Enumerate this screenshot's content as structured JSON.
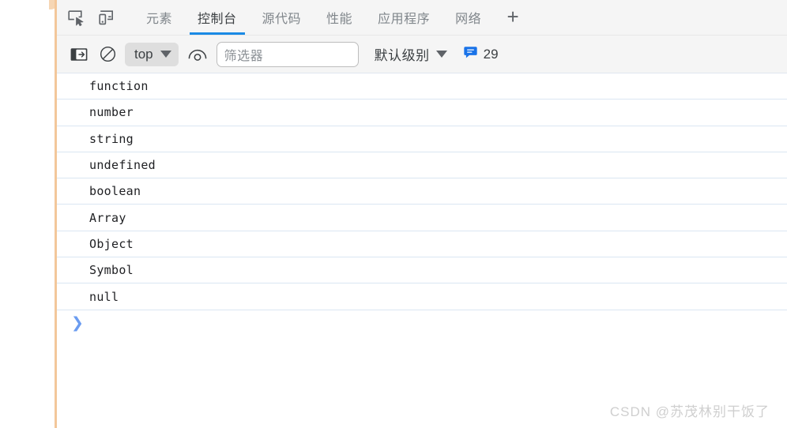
{
  "window": {
    "app": "Chrome DevTools",
    "panel_active": "控制台"
  },
  "tabbar": {
    "inspect_icon": "inspect-element-icon",
    "device_icon": "device-toolbar-icon",
    "add_label": "+",
    "tabs": [
      {
        "label": "元素",
        "active": false
      },
      {
        "label": "控制台",
        "active": true
      },
      {
        "label": "源代码",
        "active": false
      },
      {
        "label": "性能",
        "active": false
      },
      {
        "label": "应用程序",
        "active": false
      },
      {
        "label": "网络",
        "active": false
      }
    ]
  },
  "console_toolbar": {
    "sidebar_toggle_icon": "console-sidebar-toggle-icon",
    "clear_icon": "clear-console-icon",
    "context_value": "top",
    "live_expression_icon": "live-expression-eye-icon",
    "filter_placeholder": "筛选器",
    "filter_value": "",
    "level_label": "默认级别",
    "message_count": "29",
    "message_icon": "speech-bubble-icon"
  },
  "console_log": {
    "rows": [
      {
        "text": "function"
      },
      {
        "text": "number"
      },
      {
        "text": "string"
      },
      {
        "text": "undefined"
      },
      {
        "text": "boolean"
      },
      {
        "text": "Array"
      },
      {
        "text": "Object"
      },
      {
        "text": "Symbol"
      },
      {
        "text": "null"
      }
    ],
    "prompt_symbol": "❯"
  },
  "watermark": {
    "text": "CSDN @苏茂林别干饭了"
  },
  "colors": {
    "accent_blue": "#1a8ae5",
    "toolbar_bg": "#f5f5f5",
    "row_separator": "#dae6f2",
    "prompt_blue": "#6b9cf0",
    "page_edge": "#f3c79a"
  }
}
